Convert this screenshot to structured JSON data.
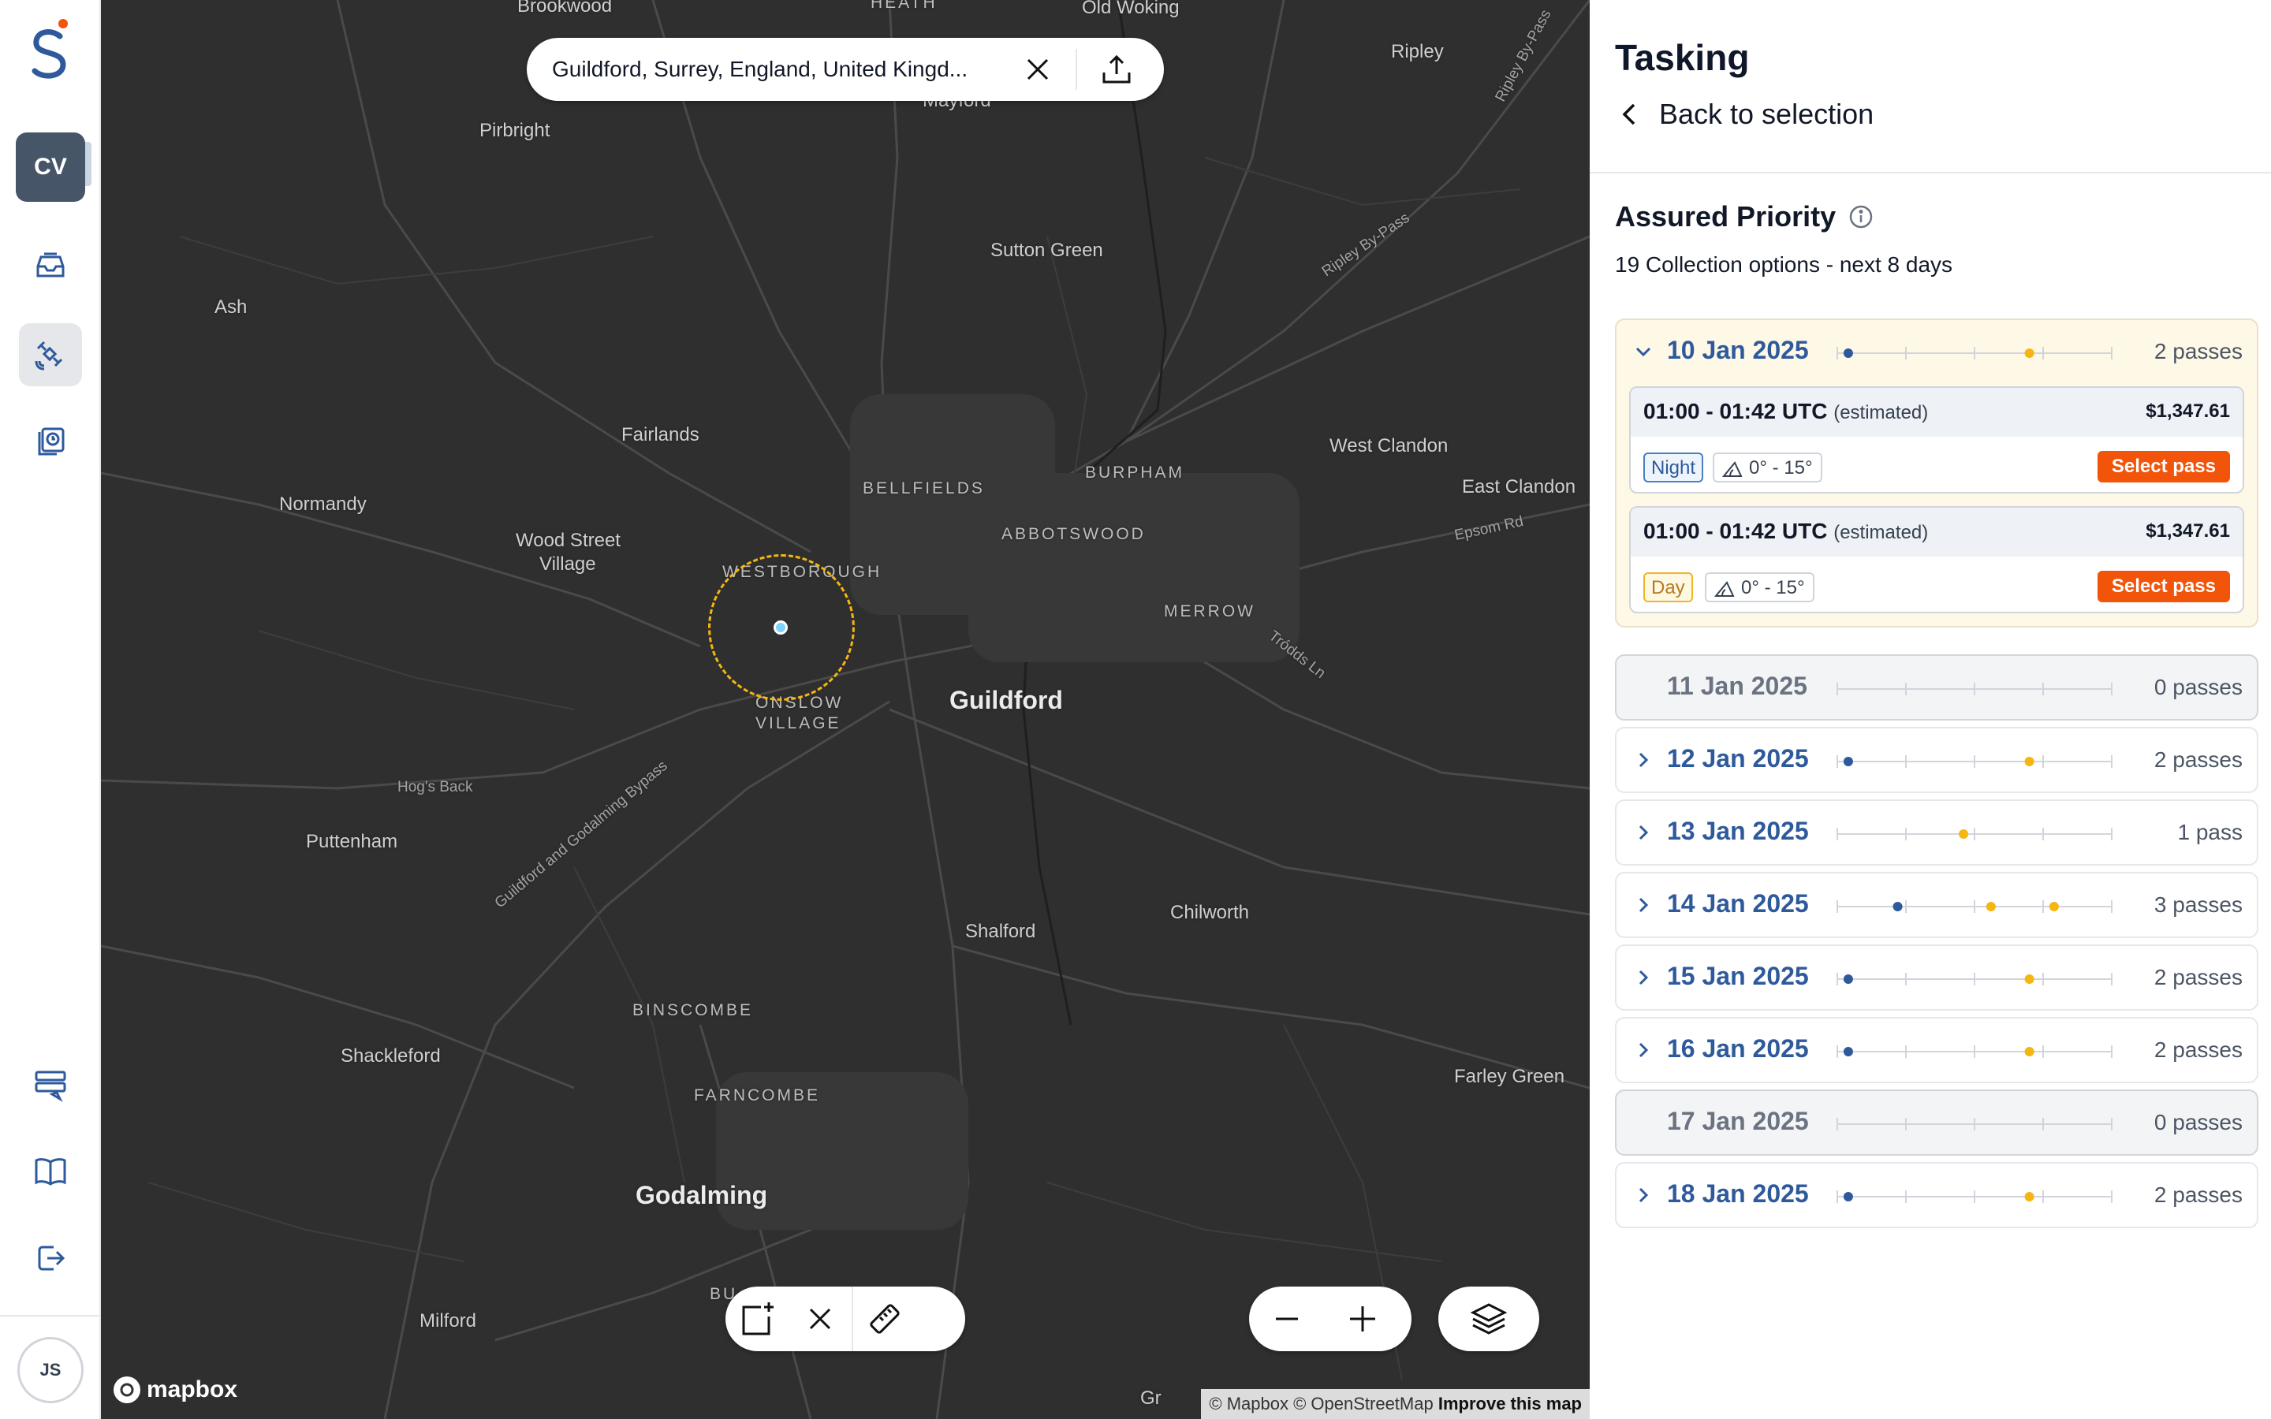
{
  "rail": {
    "workspace": "CV",
    "user_initials": "JS",
    "icons": [
      "inbox-icon",
      "satellite-icon",
      "history-icon",
      "settings-list-icon",
      "book-icon",
      "logout-icon"
    ]
  },
  "map": {
    "search_query": "Guildford, Surrey, England, United Kingd...",
    "labels": [
      {
        "text": "Brookwood",
        "cls": ""
      },
      {
        "text": "HEATH",
        "cls": "small"
      },
      {
        "text": "Old Woking",
        "cls": ""
      },
      {
        "text": "Ripley",
        "cls": ""
      },
      {
        "text": "Ripley By-Pass",
        "cls": "road"
      },
      {
        "text": "Mayford",
        "cls": ""
      },
      {
        "text": "Pirbright",
        "cls": ""
      },
      {
        "text": "Ash",
        "cls": ""
      },
      {
        "text": "Sutton Green",
        "cls": ""
      },
      {
        "text": "Ripley By-Pass",
        "cls": "road"
      },
      {
        "text": "Fairlands",
        "cls": ""
      },
      {
        "text": "BELLFIELDS",
        "cls": "small"
      },
      {
        "text": "BURPHAM",
        "cls": "small"
      },
      {
        "text": "West Clandon",
        "cls": ""
      },
      {
        "text": "East Clandon",
        "cls": ""
      },
      {
        "text": "Normandy",
        "cls": ""
      },
      {
        "text": "Epsom Rd",
        "cls": "road"
      },
      {
        "text": "Wood Street",
        "cls": ""
      },
      {
        "text": "Village",
        "cls": ""
      },
      {
        "text": "ABBOTSWOOD",
        "cls": "small"
      },
      {
        "text": "WESTBOROUGH",
        "cls": "small"
      },
      {
        "text": "MERROW",
        "cls": "small"
      },
      {
        "text": "Tródds Ln",
        "cls": "road"
      },
      {
        "text": "Guildford",
        "cls": "big"
      },
      {
        "text": "ONSLOW",
        "cls": "small"
      },
      {
        "text": "VILLAGE",
        "cls": "small"
      },
      {
        "text": "Hog's Back",
        "cls": "road"
      },
      {
        "text": "Puttenham",
        "cls": ""
      },
      {
        "text": "Guildford and Godalming Bypass",
        "cls": "road"
      },
      {
        "text": "Chilworth",
        "cls": ""
      },
      {
        "text": "Shalford",
        "cls": ""
      },
      {
        "text": "BINSCOMBE",
        "cls": "small"
      },
      {
        "text": "Shackleford",
        "cls": ""
      },
      {
        "text": "Farley Green",
        "cls": ""
      },
      {
        "text": "FARNCOMBE",
        "cls": "small"
      },
      {
        "text": "Godalming",
        "cls": "big"
      },
      {
        "text": "Milford",
        "cls": ""
      },
      {
        "text": "BU",
        "cls": "small"
      },
      {
        "text": "Gr",
        "cls": ""
      }
    ],
    "brand": "mapbox",
    "attribution": "© Mapbox © OpenStreetMap",
    "attribution_link": "Improve this map"
  },
  "panel": {
    "title": "Tasking",
    "back_label": "Back to selection",
    "tier": "Assured Priority",
    "summary": "19 Collection options - next 8 days",
    "select_label": "Select pass",
    "days": [
      {
        "date": "10 Jan 2025",
        "count": "2 passes",
        "state": "expanded",
        "dots": [
          {
            "pos": 0.04,
            "type": "night"
          },
          {
            "pos": 0.7,
            "type": "day"
          }
        ],
        "passes": [
          {
            "time": "01:00 - 01:42 UTC",
            "note": "(estimated)",
            "price": "$1,347.61",
            "light": "Night",
            "angle": "0° - 15°"
          },
          {
            "time": "01:00 - 01:42 UTC",
            "note": "(estimated)",
            "price": "$1,347.61",
            "light": "Day",
            "angle": "0° - 15°"
          }
        ]
      },
      {
        "date": "11 Jan 2025",
        "count": "0 passes",
        "state": "empty",
        "dots": []
      },
      {
        "date": "12 Jan 2025",
        "count": "2 passes",
        "state": "collapsed",
        "dots": [
          {
            "pos": 0.04,
            "type": "night"
          },
          {
            "pos": 0.7,
            "type": "day"
          }
        ]
      },
      {
        "date": "13 Jan 2025",
        "count": "1 pass",
        "state": "collapsed",
        "dots": [
          {
            "pos": 0.46,
            "type": "day"
          }
        ]
      },
      {
        "date": "14 Jan 2025",
        "count": "3 passes",
        "state": "collapsed",
        "dots": [
          {
            "pos": 0.22,
            "type": "night"
          },
          {
            "pos": 0.56,
            "type": "day"
          },
          {
            "pos": 0.79,
            "type": "day"
          }
        ]
      },
      {
        "date": "15 Jan 2025",
        "count": "2 passes",
        "state": "collapsed",
        "dots": [
          {
            "pos": 0.04,
            "type": "night"
          },
          {
            "pos": 0.7,
            "type": "day"
          }
        ]
      },
      {
        "date": "16 Jan 2025",
        "count": "2 passes",
        "state": "collapsed",
        "dots": [
          {
            "pos": 0.04,
            "type": "night"
          },
          {
            "pos": 0.7,
            "type": "day"
          }
        ]
      },
      {
        "date": "17 Jan 2025",
        "count": "0 passes",
        "state": "empty",
        "dots": []
      },
      {
        "date": "18 Jan 2025",
        "count": "2 passes",
        "state": "collapsed",
        "dots": [
          {
            "pos": 0.04,
            "type": "night"
          },
          {
            "pos": 0.7,
            "type": "day"
          }
        ]
      }
    ]
  },
  "colors": {
    "night": "#2e5a9c",
    "day": "#f5b60f",
    "accent": "#f2540a",
    "map_bg": "#2f2f2f"
  }
}
